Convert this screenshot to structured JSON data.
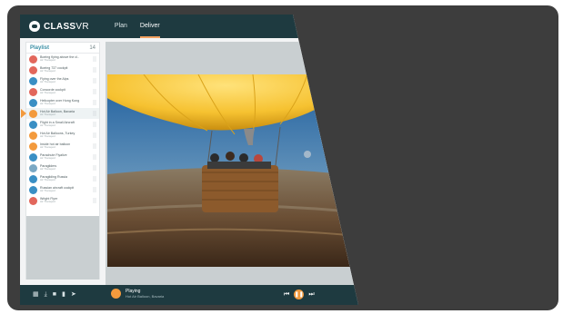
{
  "app": {
    "brand": "CLASS",
    "brand_suffix": "VR"
  },
  "nav": {
    "tabs": [
      {
        "label": "Plan",
        "active": false
      },
      {
        "label": "Deliver",
        "active": true
      }
    ]
  },
  "playlist": {
    "title": "Playlist",
    "count": "14",
    "items": [
      {
        "title": "Boeing flying above the cl..",
        "sub": "Air Transport",
        "thumb": "#e2675c",
        "selected": false
      },
      {
        "title": "Boeing 737 cockpit",
        "sub": "Air Transport",
        "thumb": "#e2675c",
        "selected": false
      },
      {
        "title": "Flying over the Alps",
        "sub": "Air Transport",
        "thumb": "#3a8fc4",
        "selected": false
      },
      {
        "title": "Concorde cockpit",
        "sub": "Air Transport",
        "thumb": "#e2675c",
        "selected": false
      },
      {
        "title": "Helicopter over Hong Kong",
        "sub": "Air Transport",
        "thumb": "#3a8fc4",
        "selected": false
      },
      {
        "title": "Hot Air Balloon, Bavaria",
        "sub": "Air Transport",
        "thumb": "#f39a3d",
        "selected": true
      },
      {
        "title": "Flight in a Small Aircraft",
        "sub": "Air Transport",
        "thumb": "#3a8fc4",
        "selected": false
      },
      {
        "title": "Hot Air Balloons, Turkey",
        "sub": "Air Transport",
        "thumb": "#f39a3d",
        "selected": false
      },
      {
        "title": "Inside hot air balloon",
        "sub": "Air Transport",
        "thumb": "#f39a3d",
        "selected": false
      },
      {
        "title": "Parachute Flyalive",
        "sub": "Air Transport",
        "thumb": "#3a8fc4",
        "selected": false
      },
      {
        "title": "Paragliders",
        "sub": "Air Transport",
        "thumb": "#7aa8c4",
        "selected": false
      },
      {
        "title": "Paragliding Russia",
        "sub": "Air Transport",
        "thumb": "#3a8fc4",
        "selected": false
      },
      {
        "title": "Russian aircraft cockpit",
        "sub": "Air Transport",
        "thumb": "#3a8fc4",
        "selected": false
      },
      {
        "title": "Wright Flyer",
        "sub": "Air Transport",
        "thumb": "#e2675c",
        "selected": false
      }
    ]
  },
  "bottom": {
    "status": "Playing",
    "now_title": "Hot Air Balloon, Bavaria",
    "controls": [
      "grid-icon",
      "download-icon",
      "lock-icon",
      "trash-icon",
      "send-icon"
    ],
    "transport": {
      "prev": "previous-icon",
      "pause": "pause-icon",
      "next": "next-icon"
    }
  },
  "colors": {
    "topbar": "#1e3a40",
    "accent": "#f39a3d",
    "background": "#3d3d3d"
  }
}
